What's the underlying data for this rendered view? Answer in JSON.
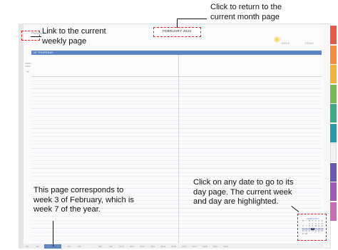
{
  "planner": {
    "app_label": "Planner",
    "month_title": "FEBRUARY 2023",
    "week_link": "WEEK",
    "today_link": "TODAY",
    "day_bar_label": "16   THURSDAY",
    "left_rail_text": [
      "WEEK",
      "VIEW"
    ],
    "left_rail_arrow": "→",
    "bottom_weeks": [
      "W1",
      "W2",
      "W3",
      "W4",
      "W5",
      "W6",
      "W7",
      "W8",
      "W9",
      "W10",
      "W11",
      "W12",
      "W13",
      "W14",
      "W15",
      "W16",
      "W17",
      "W18",
      "W19",
      "W20"
    ],
    "side_tabs": [
      {
        "name": "jan",
        "color": "#e25b4a"
      },
      {
        "name": "feb",
        "color": "#f08c3c"
      },
      {
        "name": "mar",
        "color": "#f3b23c"
      },
      {
        "name": "apr",
        "color": "#79b956"
      },
      {
        "name": "may",
        "color": "#3fa884"
      },
      {
        "name": "jun",
        "color": "#2d9aa5"
      },
      {
        "name": "jul",
        "color": "#f2f2f4"
      },
      {
        "name": "aug",
        "color": "#6b58b3"
      },
      {
        "name": "sep",
        "color": "#9a5bb5"
      },
      {
        "name": "oct",
        "color": "#c96cb6"
      }
    ],
    "mini_calendar": {
      "title": "FEBRUARY",
      "weekday_headers": [
        "M",
        "T",
        "W",
        "T",
        "F",
        "S",
        "S"
      ],
      "rows": [
        [
          "",
          "",
          "1",
          "2",
          "3",
          "4",
          "5"
        ],
        [
          "6",
          "7",
          "8",
          "9",
          "10",
          "11",
          "12"
        ],
        [
          "13",
          "14",
          "15",
          "16",
          "17",
          "18",
          "19"
        ],
        [
          "20",
          "21",
          "22",
          "23",
          "24",
          "25",
          "26"
        ],
        [
          "27",
          "28",
          "",
          "",
          "",
          "",
          ""
        ]
      ]
    }
  },
  "annotations": {
    "return_month": [
      "Click to return to the",
      "current month page"
    ],
    "weekly_link": [
      "Link to the current",
      "weekly page"
    ],
    "week_info": [
      "This page corresponds to",
      "week 3 of February, which is",
      "week 7 of the year."
    ],
    "date_info": [
      "Click on any date to go to its",
      "day page. The current week",
      "and day are highlighted."
    ]
  },
  "colors": {
    "accent_blue": "#5b84c4",
    "annotation_red": "#e0241c"
  }
}
